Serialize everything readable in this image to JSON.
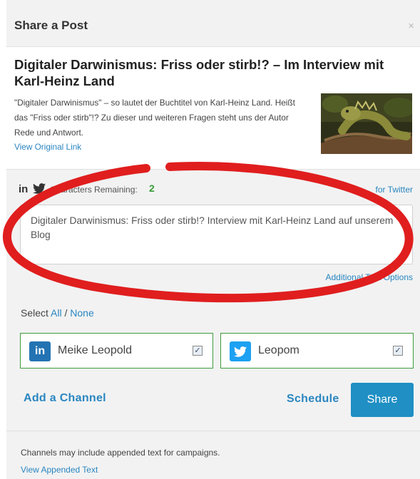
{
  "dialog": {
    "title": "Share a Post",
    "close_icon": "×"
  },
  "post": {
    "title": "Digitaler Darwinismus: Friss oder stirb!? – Im Interview mit Karl-Heinz Land",
    "description": "\"Digitaler Darwinismus\" – so lautet der Buchtitel von Karl-Heinz Land. Heißt das \"Friss oder stirb\"!? Zu dieser und weiteren Fragen steht uns der Autor Rede und Antwort.",
    "view_link": "View Original Link",
    "image_icon": "iguana-photo"
  },
  "composer": {
    "social_linkedin": "in",
    "counter_label": "Characters Remaining:",
    "counter_value": "2",
    "customize_link": "for Twitter",
    "message": "Digitaler Darwinismus: Friss oder stirb!? Interview mit Karl-Heinz Land auf unserem Blog",
    "additional_link": "Additional Text Options"
  },
  "select": {
    "label": "Select",
    "all": "All",
    "separator": "/",
    "none": "None"
  },
  "channels": [
    {
      "name": "Meike Leopold",
      "network": "linkedin",
      "icon_text": "in",
      "checked": true
    },
    {
      "name": "Leopom",
      "network": "twitter",
      "icon_text": "",
      "checked": true
    }
  ],
  "actions": {
    "add_channel": "Add a Channel",
    "schedule": "Schedule",
    "share": "Share"
  },
  "footer": {
    "note": "Channels may include appended text for campaigns.",
    "link": "View Appended Text"
  },
  "colors": {
    "accent": "#2a86c0",
    "share_button": "#1f8fc4",
    "channel_border": "#3e9a3e",
    "counter_ok": "#3a9b3a",
    "annotation_red": "#e01e1e"
  }
}
